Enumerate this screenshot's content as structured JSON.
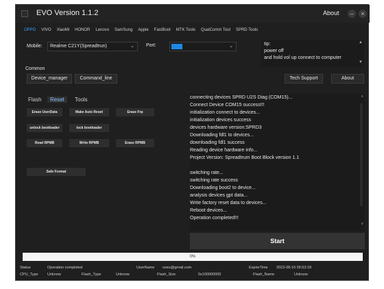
{
  "window": {
    "title": "EVO Version 1.1.2",
    "about_label": "About"
  },
  "brand_tabs": [
    "OPPO",
    "VIVO",
    "XiaoMi",
    "HONOR",
    "Lenovo",
    "SamSung",
    "Apple",
    "FastBoot",
    "MTK Tools",
    "QualComm Tool",
    "SPRD Tools"
  ],
  "brand_tab_active": "OPPO",
  "device": {
    "mobile_label": "Mobile:",
    "mobile_value": "Realme C21Y(Spreadtrun)",
    "port_label": "Port:"
  },
  "tip": {
    "lines": [
      "tip:",
      "power off",
      "and hold vol up connect to computer"
    ]
  },
  "common": {
    "label": "Common",
    "device_manager": "Device_manager",
    "command_line": "Command_line",
    "tech_support": "Tech Support",
    "about": "About"
  },
  "sub_tabs": [
    "Flash",
    "Reset",
    "Tools"
  ],
  "sub_tab_active": "Reset",
  "operations": {
    "erase_userdata": "Erase UserData",
    "make_auto_reset": "Make Auto Reset",
    "erase_frp": "Erase Frp",
    "unlock_bootloader": "unlock bootloader",
    "lock_bootloader": "lock bootloader",
    "read_rpmb": "Read RPMB",
    "write_rpmb": "Write RPMB",
    "erase_rpmb": "Erase RPMB",
    "safe_format": "Safe Format"
  },
  "log": [
    "connecting devices SPRD U2S Diag (COM15)...",
    "Connect Device COM15 success!!!",
    "initialization connect to devices...",
    "initialization devices success",
    "devices hardware version:SPRD3",
    "Downloading fdl1 to devices...",
    "downloading fdl1 success",
    "Reading device hardware info...",
    "Project Version: Spreadtrum Boot Block version 1.1",
    "",
    "switching rate...",
    "switching rate success",
    "Downloading boot2 to device...",
    "analysis devices gpt data...",
    "Write factory reset data to devices...",
    "Reboot devices...",
    "Operation completed!!!"
  ],
  "start_label": "Start",
  "progress": {
    "percent": 0,
    "text": "0%"
  },
  "status_bar": {
    "status_label": "Status",
    "status_value": "Operation completed",
    "username_label": "UserName",
    "username_value": "sosu@gmail.com",
    "expire_label": "ExpireTime",
    "expire_value": "2023-08-10 06:53:18",
    "cpu_type_label": "CPU_Type",
    "cpu_type_value": "Unknow",
    "flash_type_label": "Flash_Type",
    "flash_type_value": "Unknow",
    "flash_size_label": "Flash_Size",
    "flash_size_value": "0x100000000",
    "flash_name_label": "Flash_Name",
    "flash_name_value": "Unknow"
  },
  "colors": {
    "accent": "#3d9bff",
    "background": "#1f1f1f",
    "port_swatch": "#1e88e5"
  },
  "icons": {
    "minimize": "minimize-icon",
    "close": "close-icon",
    "dropdown": "chevron-down-icon",
    "scroll_up": "scroll-up-icon",
    "scroll_down": "scroll-down-icon"
  }
}
